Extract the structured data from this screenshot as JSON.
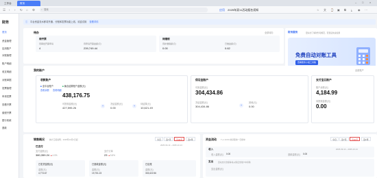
{
  "browser": {
    "tabs": [
      "工作台",
      "财务"
    ],
    "url_placeholder": "搜索",
    "page_label": "应用",
    "page_title": "2025年双11活动报名须知"
  },
  "sidebar": {
    "title": "财务",
    "items": [
      {
        "label": "首页",
        "active": true
      },
      {
        "label": "资金管理",
        "active": false
      },
      {
        "label": "应用账户",
        "active": false
      },
      {
        "label": "对账管理",
        "active": false
      },
      {
        "label": "账户明细",
        "active": false
      },
      {
        "label": "收支明细",
        "active": false
      },
      {
        "label": "对账单据",
        "active": false
      },
      {
        "label": "发票管理",
        "active": false
      },
      {
        "label": "申请发票",
        "active": false
      },
      {
        "label": "查看开票",
        "active": false
      },
      {
        "label": "缴税开票",
        "active": false
      },
      {
        "label": "银行收款",
        "active": false
      },
      {
        "label": "退款",
        "active": false
      }
    ]
  },
  "notice": {
    "text": "平台资金流水即将开通、分账和发票功能上线，欢迎试用",
    "link": "查看详情"
  },
  "todo": {
    "title": "待办",
    "more": "全部待办",
    "cells": [
      {
        "heading": "待开票",
        "items": [
          {
            "k": "待审批开票申请",
            "v": "4"
          },
          {
            "k": "待申请开票金额(元)",
            "v": "239,749.44"
          }
        ]
      },
      {
        "heading": "待缴税",
        "items": [
          {
            "k": "待补缴税额(元)",
            "v": "0.00"
          },
          {
            "k": "已缴金额(元)",
            "v": "0.62"
          }
        ]
      }
    ]
  },
  "finance_service": {
    "tab_active": "财务服务",
    "tab_other": "更好的了解财务和规范，配置后快速使用",
    "link": "全部",
    "headline": "免费自动对账工具",
    "button": "查看账务小组工具箱"
  },
  "accounts": {
    "title": "我的账户",
    "link": "全部账户",
    "receipt": {
      "title": "收款账户",
      "sub_tabs": [
        "全平台账户",
        "聚合结算账户金额(元)"
      ],
      "links": [
        "查看余额",
        "查看明细"
      ],
      "amount": "438,176.75",
      "available_label": "可提现金额(元)",
      "available": "427,595.26",
      "frozen_label": "冻结金额(元)",
      "frozen": "0.00",
      "pending_label": "待结算(元)",
      "pending": "10,621.49"
    },
    "settlement": {
      "title": "保证金账户",
      "available_label": "可用金额(元)",
      "amount": "304,434.86",
      "frozen_label": "冻结金额(元)",
      "frozen": "304,434.86",
      "other_label": "其他(元)",
      "other": "0.00"
    },
    "payment": {
      "title": "支付宝云账户",
      "balance_label": "账户余额(元)",
      "balance": "4,184.99",
      "withdraw_label": "待提现金额(元)",
      "withdraw": "0.00"
    }
  },
  "sales": {
    "title": "销售概况",
    "hint": "统计口径说明：2025年10月1日起",
    "ranges": [
      "今日",
      "近7天",
      "近30天",
      "近1年"
    ],
    "active_range": "近30天",
    "date_span": "2025-09-13 ~ 2025-10-13",
    "sub_title": "已支付",
    "paid_label": "支付金额(元)",
    "paid": "380,359.24",
    "paid_change": "4.0%",
    "order_label": "支付订单",
    "orders": "23",
    "orders_change": "5.8%",
    "boxes": [
      {
        "title": "已发货金额(元)",
        "k": "金额(元)",
        "v": "4,773.67"
      },
      {
        "title": "已退款金额(元)",
        "k": "金额(元)",
        "v": "19,751.23"
      },
      {
        "title": "已出账",
        "k": "金额(元)",
        "v": "303,622.56"
      }
    ]
  },
  "funds": {
    "title": "资金流动",
    "hint": "T+1 16:00 前获取前一日账单",
    "ranges": [
      "今日",
      "近7天",
      "近30天",
      "近1年"
    ],
    "active_range": "近30天",
    "date_span": "2025-09-13 ~ 2025-10-13",
    "income_title": "收入",
    "income_k": "收入金额(元)",
    "income_v": "0.00",
    "expense_k": "退款金额(元)",
    "expense_v": "0.00",
    "outflow_title": "支出",
    "outflow_hint": "自动支付金额等将从保证金账户中扣除",
    "outflow_k": "支出金额(元)"
  }
}
